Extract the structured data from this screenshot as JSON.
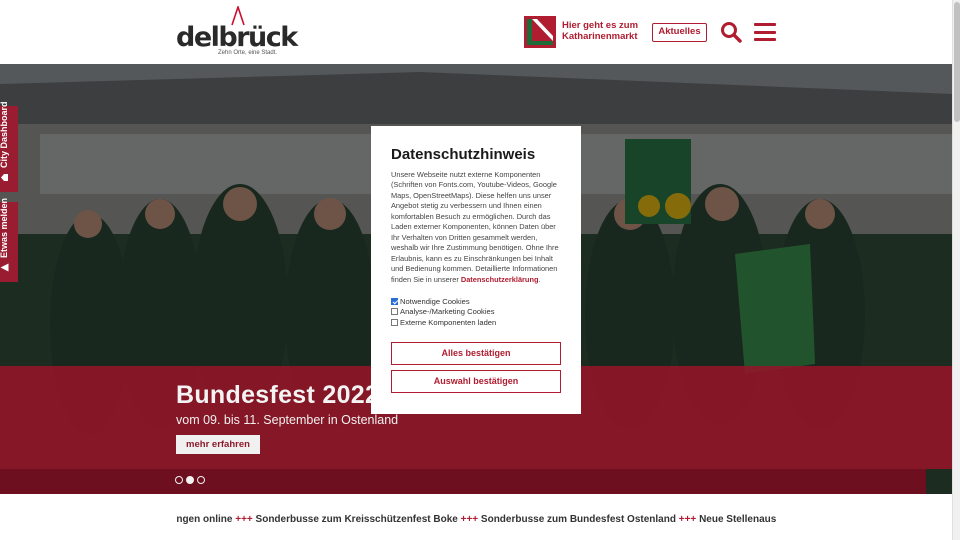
{
  "header": {
    "logo_text": "delbrück",
    "logo_tagline": "Zehn Orte, eine Stadt.",
    "promo_text": "Hier geht es zum Katharinenmarkt",
    "aktuelles_label": "Aktuelles"
  },
  "side_tabs": [
    {
      "label": "City Dashboard"
    },
    {
      "label": "Etwas melden"
    }
  ],
  "slider": {
    "title": "Bundesfest 2022",
    "subtitle": "vom 09. bis 11. September in Ostenland",
    "more_label": "mehr erfahren",
    "dots": 3,
    "active_dot": 2
  },
  "ticker": {
    "items": [
      "...ngen online",
      "Sonderbusse zum Kreisschützenfest Boke",
      "Sonderbusse zum Bundesfest Ostenland",
      "Neue Stellenausschreibungen"
    ],
    "separator": "+++"
  },
  "modal": {
    "title": "Datenschutzhinweis",
    "body": "Unsere Webseite nutzt externe Komponenten (Schriften von Fonts.com, Youtube-Videos, Google Maps, OpenStreetMaps). Diese helfen uns unser Angebot stetig zu verbessern und Ihnen einen komfortablen Besuch zu ermöglichen. Durch das Laden externer Komponenten, können Daten über Ihr Verhalten von Dritten gesammelt werden, weshalb wir Ihre Zustimmung benötigen. Ohne Ihre Erlaubnis, kann es zu Einschränkungen bei Inhalt und Bedienung kommen. Detaillierte Informationen finden Sie in unserer",
    "privacy_link": "Datenschutzerklärung",
    "checkboxes": [
      {
        "label": "Notwendige Cookies",
        "checked": true
      },
      {
        "label": "Analyse-/Marketing Cookies",
        "checked": false
      },
      {
        "label": "Externe Komponenten laden",
        "checked": false
      }
    ],
    "accept_all_label": "Alles bestätigen",
    "accept_selection_label": "Auswahl bestätigen"
  },
  "colors": {
    "accent": "#b01d30",
    "band": "#96142a",
    "band_dark": "#6e0f20"
  }
}
